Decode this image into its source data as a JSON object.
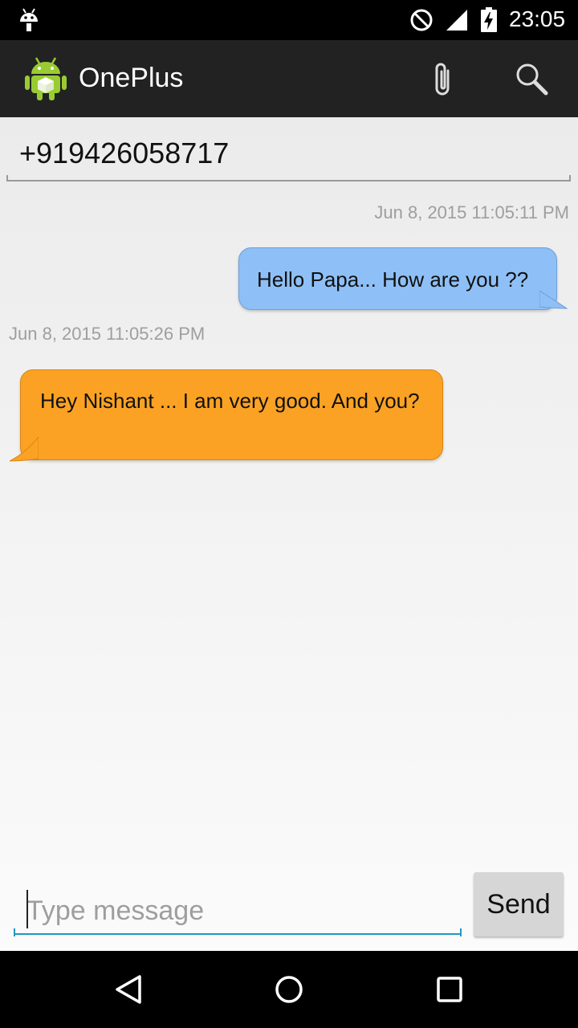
{
  "status_bar": {
    "time": "23:05",
    "icons": [
      "android-notification-icon",
      "do-not-disturb-icon",
      "signal-icon",
      "battery-charging-icon"
    ]
  },
  "action_bar": {
    "title": "OnePlus",
    "icons": [
      "android-logo-icon",
      "attach-icon",
      "search-icon"
    ]
  },
  "conversation": {
    "recipient": "+919426058717",
    "messages": [
      {
        "direction": "outgoing",
        "timestamp": "Jun 8, 2015 11:05:11 PM",
        "text": "Hello Papa... How are you ??",
        "color": "#8ec0f7"
      },
      {
        "direction": "incoming",
        "timestamp": "Jun 8, 2015 11:05:26 PM",
        "text": "Hey Nishant ... I am very good. And you?",
        "color": "#fba224"
      }
    ]
  },
  "compose": {
    "placeholder": "Type message",
    "value": "",
    "send_label": "Send",
    "accent": "#2196c4"
  },
  "nav_bar": {
    "buttons": [
      "back-icon",
      "home-icon",
      "recents-icon"
    ]
  }
}
